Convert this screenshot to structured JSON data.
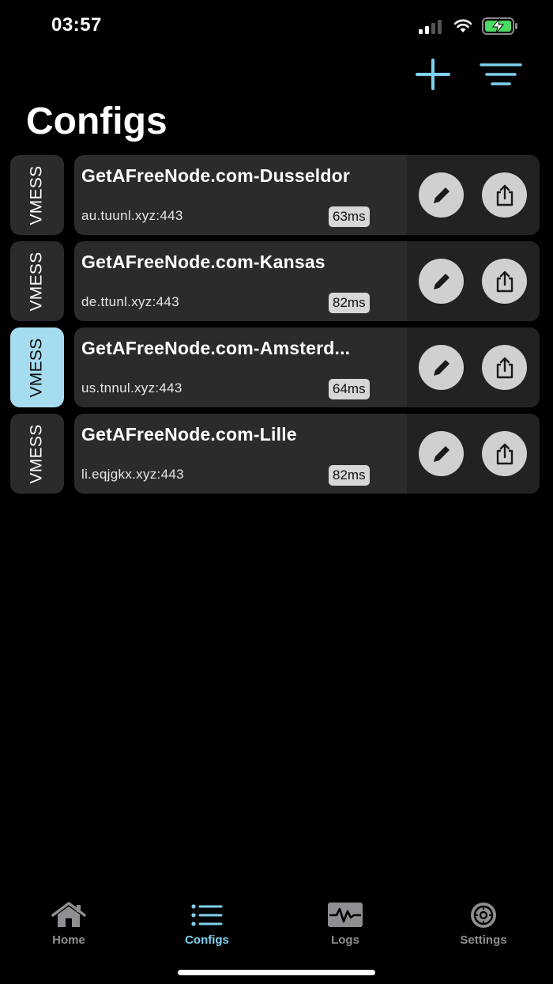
{
  "status_bar": {
    "time": "03:57",
    "icons": [
      "signal-icon",
      "wifi-icon",
      "battery-charging-icon"
    ]
  },
  "toolbar": {
    "add_icon": "plus-icon",
    "filter_icon": "filter-lines-icon",
    "accent_color": "#7fd0ee"
  },
  "page": {
    "title": "Configs"
  },
  "configs": [
    {
      "type": "VMESS",
      "name": "GetAFreeNode.com-Dusseldor",
      "address": "au.tuunl.xyz:443",
      "latency": "63ms",
      "selected": false
    },
    {
      "type": "VMESS",
      "name": "GetAFreeNode.com-Kansas",
      "address": "de.ttunl.xyz:443",
      "latency": "82ms",
      "selected": false
    },
    {
      "type": "VMESS",
      "name": "GetAFreeNode.com-Amsterd...",
      "address": "us.tnnul.xyz:443",
      "latency": "64ms",
      "selected": true
    },
    {
      "type": "VMESS",
      "name": "GetAFreeNode.com-Lille",
      "address": "li.eqjgkx.xyz:443",
      "latency": "82ms",
      "selected": false
    }
  ],
  "tabs": [
    {
      "label": "Home",
      "icon": "house-icon",
      "active": false
    },
    {
      "label": "Configs",
      "icon": "list-icon",
      "active": true
    },
    {
      "label": "Logs",
      "icon": "waveform-icon",
      "active": false
    },
    {
      "label": "Settings",
      "icon": "gear-icon",
      "active": false
    }
  ],
  "colors": {
    "background": "#000000",
    "card": "#2b2b2d",
    "selected_tag": "#a6dcef",
    "tab_inactive": "#8e8e93",
    "battery_charging": "#4cd964"
  }
}
